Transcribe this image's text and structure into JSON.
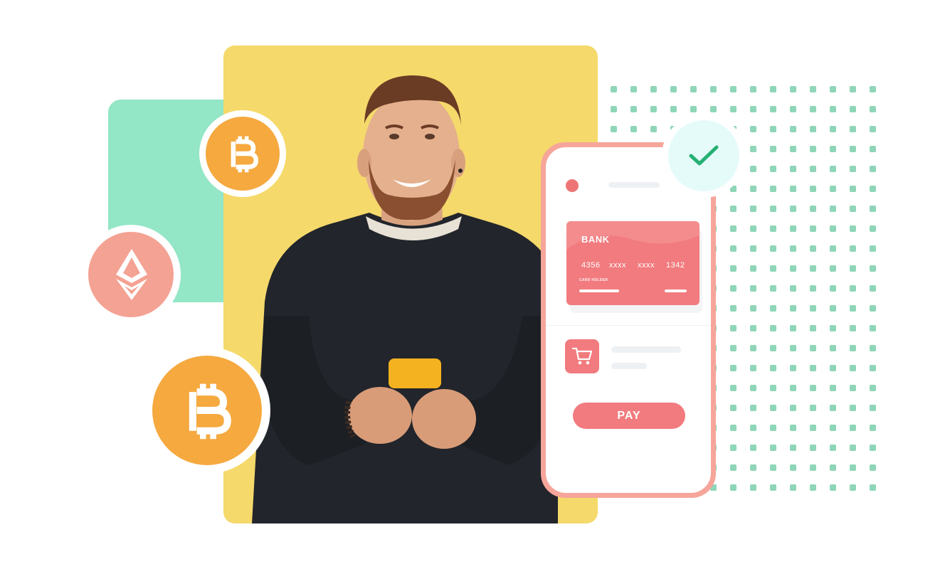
{
  "colors": {
    "yellow": "#f5d96b",
    "green": "#93e6c6",
    "bitcoin_orange": "#f5a93f",
    "ethereum_pink": "#f4a293",
    "card_red": "#f17b7e",
    "phone_frame": "#f6a59a",
    "check_green": "#25b073",
    "dot_color": "#8fd6b8"
  },
  "icons": {
    "coin_top": "bitcoin-icon",
    "coin_middle": "ethereum-icon",
    "coin_bottom": "bitcoin-icon",
    "cart": "shopping-cart-icon",
    "check": "checkmark-icon"
  },
  "phone": {
    "card": {
      "bank_label": "BANK",
      "number_groups": [
        "4356",
        "xxxx",
        "xxxx",
        "1342"
      ],
      "holder_label": "CARD HOLDER"
    },
    "pay_label": "PAY"
  }
}
